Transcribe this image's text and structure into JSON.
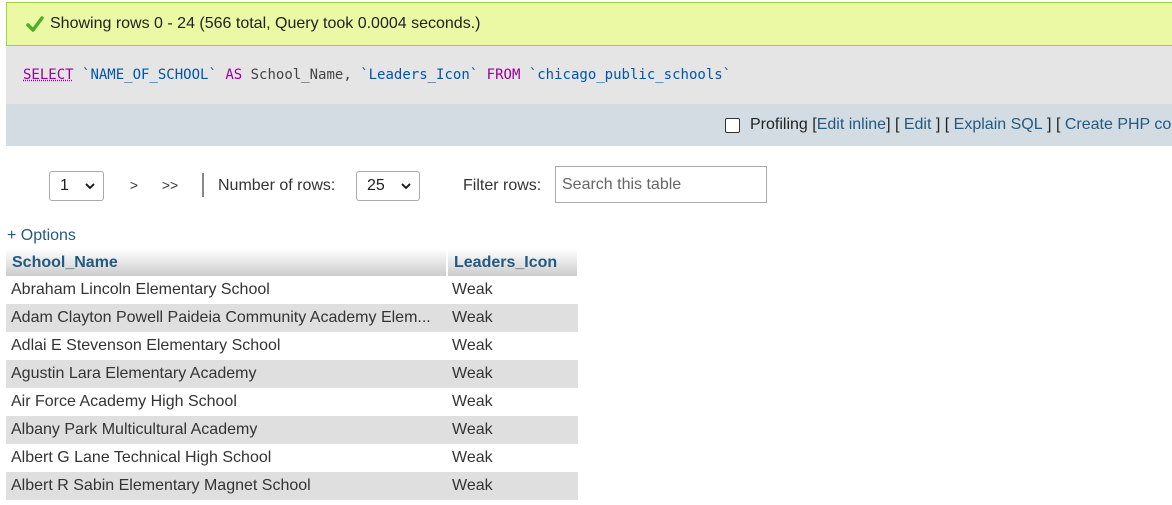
{
  "message": {
    "text": "Showing rows 0 - 24 (566 total, Query took 0.0004 seconds.)"
  },
  "sql": {
    "select": "SELECT",
    "col1": "`NAME_OF_SCHOOL`",
    "as": "AS",
    "alias": "School_Name,",
    "col2": "`Leaders_Icon`",
    "from": "FROM",
    "table": "`chicago_public_schools`"
  },
  "toolbar": {
    "profiling": "Profiling",
    "edit_inline": "Edit inline",
    "edit": "Edit",
    "explain": "Explain SQL",
    "create_php": "Create PHP code"
  },
  "nav": {
    "page_value": "1",
    "next": ">",
    "last": ">>",
    "rows_label": "Number of rows:",
    "rows_value": "25",
    "filter_label": "Filter rows:",
    "filter_placeholder": "Search this table"
  },
  "options_link": "+ Options",
  "table": {
    "headers": [
      "School_Name",
      "Leaders_Icon"
    ],
    "rows": [
      [
        "Abraham Lincoln Elementary School",
        "Weak"
      ],
      [
        "Adam Clayton Powell Paideia Community Academy Elem...",
        "Weak"
      ],
      [
        "Adlai E Stevenson Elementary School",
        "Weak"
      ],
      [
        "Agustin Lara Elementary Academy",
        "Weak"
      ],
      [
        "Air Force Academy High School",
        "Weak"
      ],
      [
        "Albany Park Multicultural Academy",
        "Weak"
      ],
      [
        "Albert G Lane Technical High School",
        "Weak"
      ],
      [
        "Albert R Sabin Elementary Magnet School",
        "Weak"
      ]
    ]
  },
  "colors": {
    "success_bg": "#ebf8a4",
    "link": "#235a81",
    "keyword": "#990099"
  }
}
